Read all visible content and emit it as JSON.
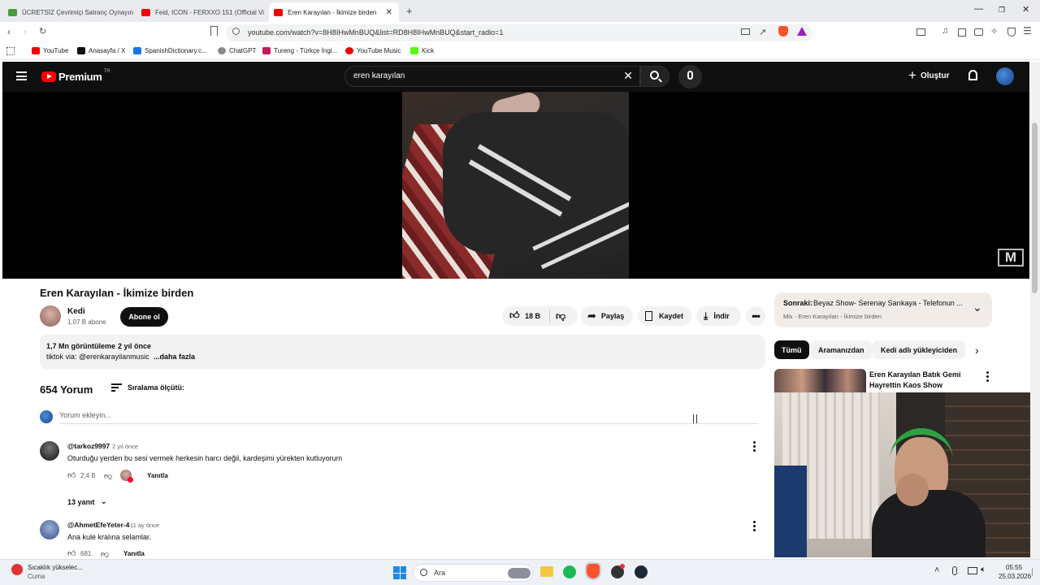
{
  "browser": {
    "tabs": [
      {
        "label": "ÜCRETSİZ Çevrimiçi Satranç Oynayın",
        "color": "#4a9a3a",
        "active": false
      },
      {
        "label": "Feid, ICON - FERXXO 151 (Official Vi",
        "color": "#e00",
        "active": false
      },
      {
        "label": "Eren Karayılan - İkimize birden",
        "color": "#e00",
        "active": true
      }
    ],
    "url": "youtube.com/watch?v=8H8IHwMnBUQ&list=RD8H8IHwMnBUQ&start_radio=1",
    "bookmarks": [
      {
        "label": "YouTube",
        "color": "#e00"
      },
      {
        "label": "Anasayfa / X",
        "color": "#111"
      },
      {
        "label": "SpanishDictionary.c...",
        "color": "#1a73e8"
      },
      {
        "label": "ChatGPT",
        "color": "#666"
      },
      {
        "label": "Tureng - Türkçe İngi...",
        "color": "#c2185b"
      },
      {
        "label": "YouTube Music",
        "color": "#e00"
      },
      {
        "label": "Kick",
        "color": "#53fc18"
      }
    ]
  },
  "header": {
    "logo_text": "Premium",
    "logo_sup": "TR",
    "search_value": "eren karayılan",
    "create_label": "Oluştur"
  },
  "video": {
    "title": "Eren Karayılan - İkimize birden",
    "channel": "Kedi",
    "subscribers": "1,07 B abone",
    "subscribe_label": "Abone ol",
    "likes": "18 B",
    "share_label": "Paylaş",
    "save_label": "Kaydet",
    "download_label": "İndir",
    "watermark": "M"
  },
  "description": {
    "views": "1,7 Mn görüntüleme",
    "age": "2 yıl önce",
    "text": "tiktok via: @erenkarayilanmusic",
    "more": "...daha fazla"
  },
  "comments": {
    "count_label": "654 Yorum",
    "sort_label": "Sıralama ölçütü:",
    "add_placeholder": "Yorum ekleyin...",
    "items": [
      {
        "author": "@tarkoz9997",
        "age": "2 yıl önce",
        "text": "Oturduğu yerden bu sesi vermek herkesin harcı değil, kardeşimi yürekten kutluyorum",
        "likes": "2,4 B",
        "reply_label": "Yanıtla",
        "replies": "13 yanıt"
      },
      {
        "author": "@AhmetEfeYeter-4",
        "age": "11 ay önce",
        "text": "Ana kule kralına selamlar.",
        "likes": "681",
        "reply_label": "Yanıtla"
      }
    ]
  },
  "sidebar": {
    "next_prefix": "Sonraki:",
    "next_title": "Beyaz Show- Serenay Sarıkaya - Telefonun ...",
    "mix_label": "Mix - Eren Karayılan - İkimize birden",
    "chips": [
      "Tümü",
      "Aramanızdan",
      "Kedi adlı yükleyiciden"
    ],
    "rec_title_1": "Eren Karayılan Batık Gemi",
    "rec_title_2": "Hayrettin Kaos Show"
  },
  "taskbar": {
    "weather_title": "Sıcaklık yükselec...",
    "weather_sub": "Cuma",
    "search_label": "Ara",
    "time": "05:55",
    "date": "25.03.2026"
  }
}
